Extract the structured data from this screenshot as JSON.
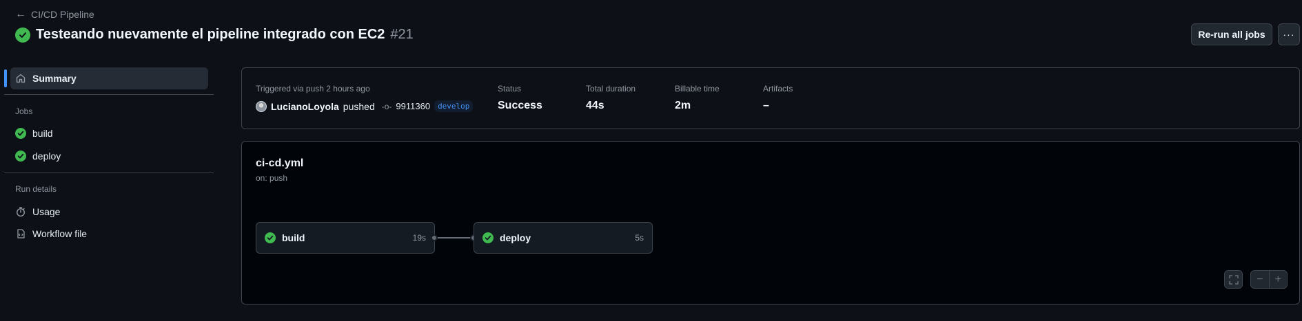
{
  "header": {
    "back_label": "CI/CD Pipeline",
    "title": "Testeando nuevamente el pipeline integrado con EC2",
    "run_number": "#21",
    "rerun_label": "Re-run all jobs",
    "more_label": "···"
  },
  "sidebar": {
    "summary_label": "Summary",
    "jobs_heading": "Jobs",
    "jobs": [
      {
        "label": "build",
        "icon": "check-circle-icon"
      },
      {
        "label": "deploy",
        "icon": "check-circle-icon"
      }
    ],
    "run_details_heading": "Run details",
    "usage_label": "Usage",
    "workflow_file_label": "Workflow file"
  },
  "summary": {
    "triggered_text": "Triggered via push 2 hours ago",
    "actor": "LucianoLoyola",
    "action": "pushed",
    "commit": "9911360",
    "branch": "develop",
    "status_label": "Status",
    "status_value": "Success",
    "duration_label": "Total duration",
    "duration_value": "44s",
    "billable_label": "Billable time",
    "billable_value": "2m",
    "artifacts_label": "Artifacts",
    "artifacts_value": "–"
  },
  "graph": {
    "workflow_name": "ci-cd.yml",
    "trigger": "on: push",
    "jobs": [
      {
        "name": "build",
        "duration": "19s"
      },
      {
        "name": "deploy",
        "duration": "5s"
      }
    ],
    "zoom_out": "−",
    "zoom_in": "+"
  },
  "colors": {
    "background": "#0d1117",
    "success": "#3fb950",
    "accent": "#4493f8",
    "border": "#3d444d"
  }
}
